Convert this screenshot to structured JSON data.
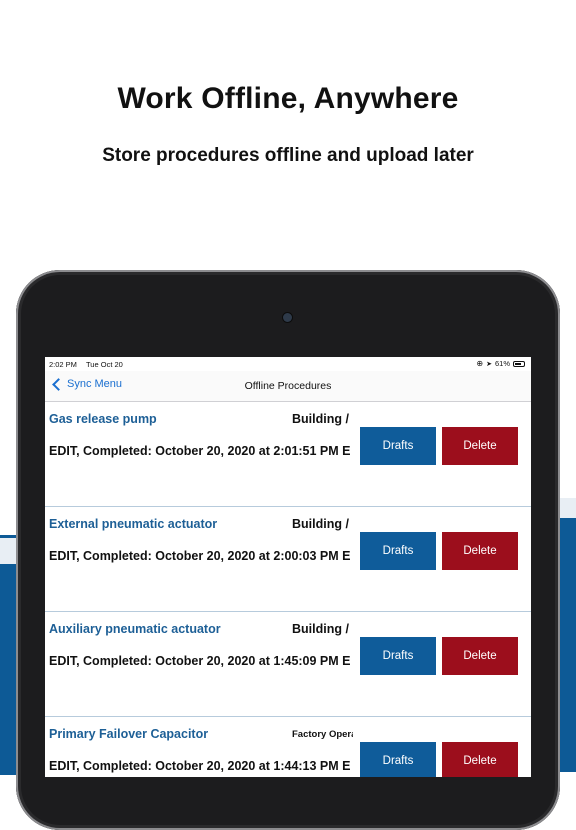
{
  "promo": {
    "headline": "Work Offline, Anywhere",
    "subhead": "Store procedures offline and upload later"
  },
  "status_bar": {
    "time": "2:02 PM",
    "date": "Tue Oct 20",
    "battery": "61%"
  },
  "nav": {
    "back_label": "Sync Menu",
    "title": "Offline Procedures"
  },
  "procedures": [
    {
      "name": "Gas release pump",
      "location": "Building /",
      "status": "EDIT, Completed: October 20, 2020 at 2:01:51 PM E",
      "drafts_label": "Drafts",
      "delete_label": "Delete"
    },
    {
      "name": "External pneumatic actuator",
      "location": "Building /",
      "status": "EDIT, Completed: October 20, 2020 at 2:00:03 PM E",
      "drafts_label": "Drafts",
      "delete_label": "Delete"
    },
    {
      "name": "Auxiliary pneumatic actuator",
      "location": "Building /",
      "status": "EDIT, Completed: October 20, 2020 at 1:45:09 PM E",
      "drafts_label": "Drafts",
      "delete_label": "Delete"
    },
    {
      "name": "Primary Failover Capacitor",
      "location": "Factory Opera",
      "status": "EDIT, Completed: October 20, 2020 at 1:44:13 PM E",
      "drafts_label": "Drafts",
      "delete_label": "Delete"
    }
  ],
  "colors": {
    "brand_blue": "#0f5c9a",
    "delete_red": "#9c0e1c",
    "link_blue": "#1a6fd0"
  }
}
